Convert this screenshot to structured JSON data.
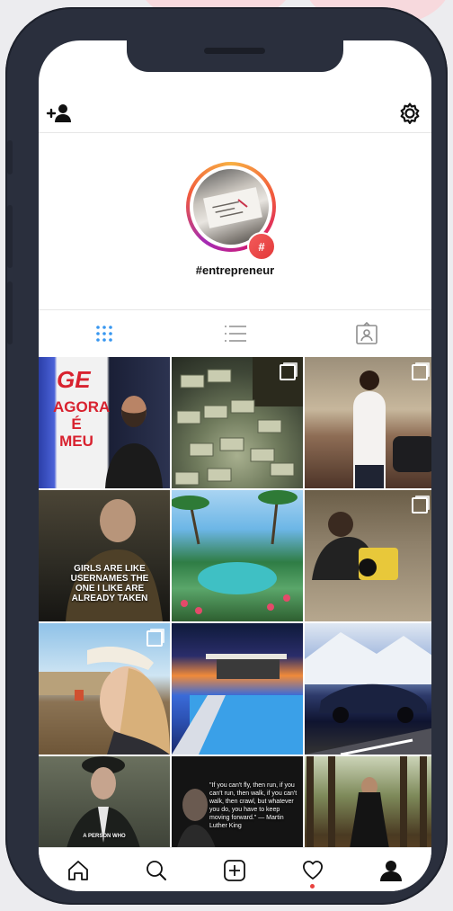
{
  "profile": {
    "handle": "#entrepreneur",
    "badge": "#"
  },
  "header": {
    "left_icon": "add-user-icon",
    "right_icon": "gear-icon"
  },
  "tabs": [
    {
      "name": "grid-view",
      "icon": "grid-icon",
      "active": true
    },
    {
      "name": "list-view",
      "icon": "list-icon",
      "active": false
    },
    {
      "name": "tagged-view",
      "icon": "tagged-user-icon",
      "active": false
    }
  ],
  "posts": [
    {
      "overlay": "GE",
      "overlay2": "AGORA É MEU",
      "multi": false
    },
    {
      "overlay": "",
      "multi": true
    },
    {
      "overlay": "",
      "multi": true
    },
    {
      "overlay": "GIRLS ARE LIKE USERNAMES THE ONE I LIKE ARE ALREADY TAKEN",
      "multi": false
    },
    {
      "overlay": "",
      "multi": false
    },
    {
      "overlay": "",
      "multi": true
    },
    {
      "overlay": "",
      "multi": true
    },
    {
      "overlay": "",
      "multi": false
    },
    {
      "overlay": "",
      "multi": false
    },
    {
      "overlay": "A PERSON WHO",
      "multi": false
    },
    {
      "overlay": "\"If you can't fly, then run, if you can't run, then walk, if you can't walk, then crawl, but whatever you do, you have to keep moving forward.\" — Martin Luther King",
      "multi": false
    },
    {
      "overlay": "",
      "multi": false
    }
  ],
  "bottom_nav": [
    {
      "name": "home",
      "icon": "home-icon"
    },
    {
      "name": "search",
      "icon": "search-icon"
    },
    {
      "name": "new-post",
      "icon": "plus-square-icon"
    },
    {
      "name": "activity",
      "icon": "heart-icon"
    },
    {
      "name": "profile",
      "icon": "user-icon"
    }
  ],
  "colors": {
    "accent_blue": "#3897f0",
    "notification_red": "#e9423f",
    "phone_frame": "#2a2f3d"
  }
}
